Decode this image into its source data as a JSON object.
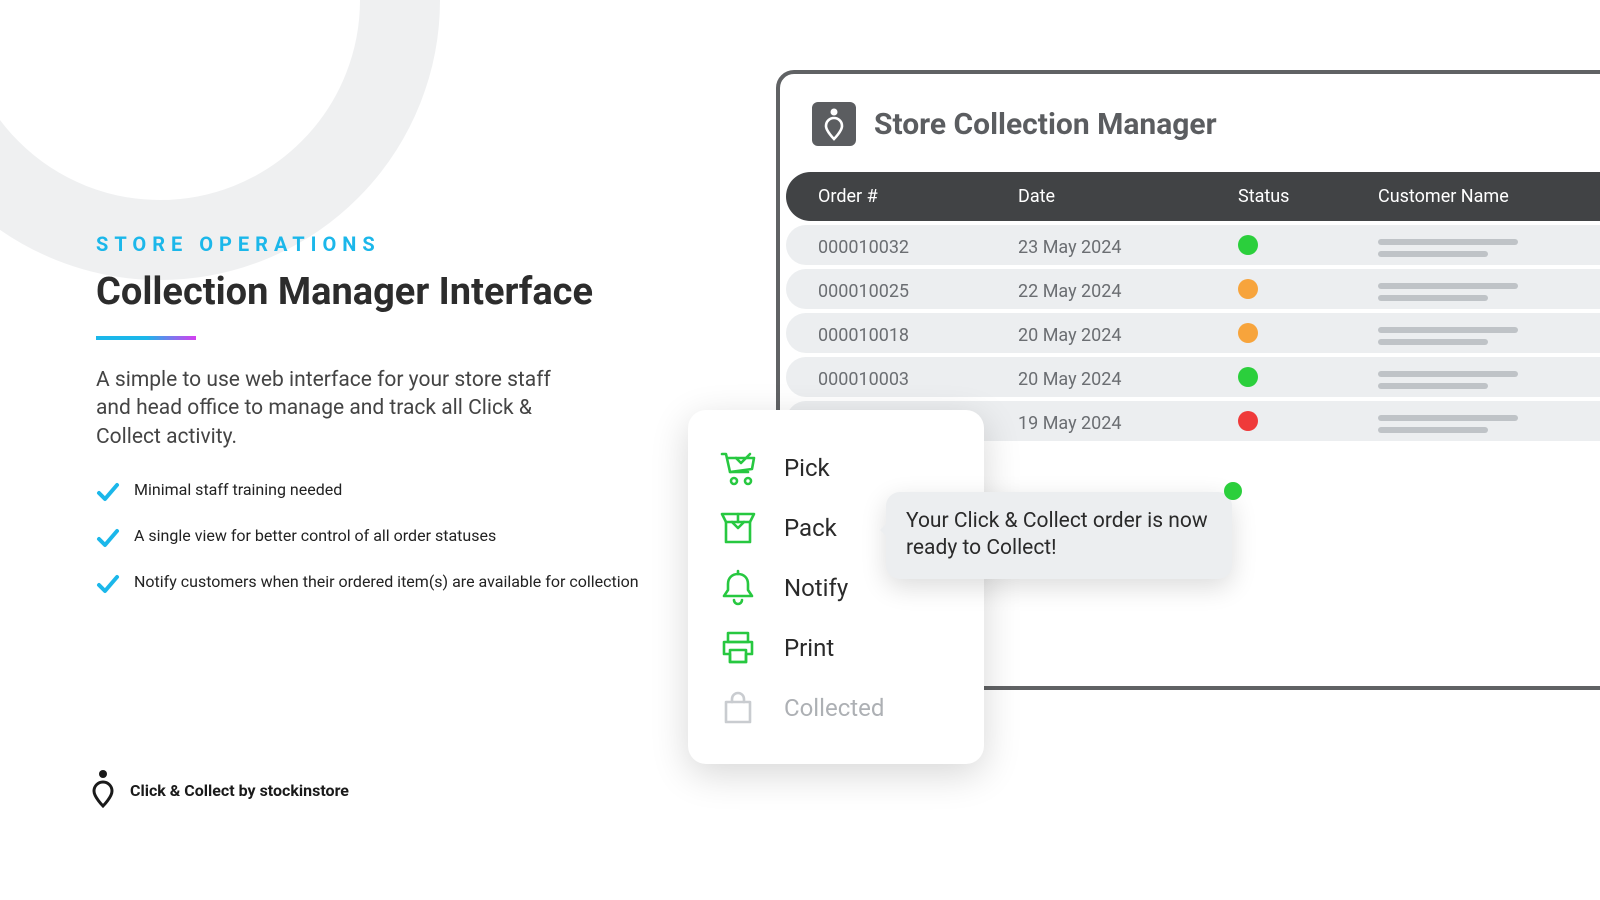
{
  "left": {
    "eyebrow": "STORE OPERATIONS",
    "headline": "Collection Manager Interface",
    "body": "A simple to use web interface for your store staff and head office to manage and track all Click & Collect activity.",
    "bullets": [
      "Minimal staff training needed",
      "A single view for better control of all order statuses",
      "Notify customers when their ordered item(s) are available for collection"
    ]
  },
  "footer": {
    "label": "Click & Collect by stockinstore"
  },
  "app": {
    "title": "Store Collection Manager",
    "columns": {
      "order": "Order #",
      "date": "Date",
      "status": "Status",
      "customer": "Customer Name"
    },
    "rows": [
      {
        "order": "000010032",
        "date": "23 May 2024",
        "status": "green"
      },
      {
        "order": "000010025",
        "date": "22 May 2024",
        "status": "orange"
      },
      {
        "order": "000010018",
        "date": "20 May 2024",
        "status": "orange"
      },
      {
        "order": "000010003",
        "date": "20 May 2024",
        "status": "green"
      },
      {
        "order": "",
        "date": "19 May 2024",
        "status": "red"
      }
    ]
  },
  "menu": {
    "pick": "Pick",
    "pack": "Pack",
    "notify": "Notify",
    "print": "Print",
    "collected": "Collected"
  },
  "notification": {
    "text": "Your Click & Collect order is now ready to Collect!"
  },
  "colors": {
    "accent_blue": "#1bb7ea",
    "accent_magenta": "#d63ef0",
    "status_green": "#2bcf3c",
    "status_orange": "#f7a43c",
    "status_red": "#ef3a3a",
    "icon_green": "#27c840"
  }
}
